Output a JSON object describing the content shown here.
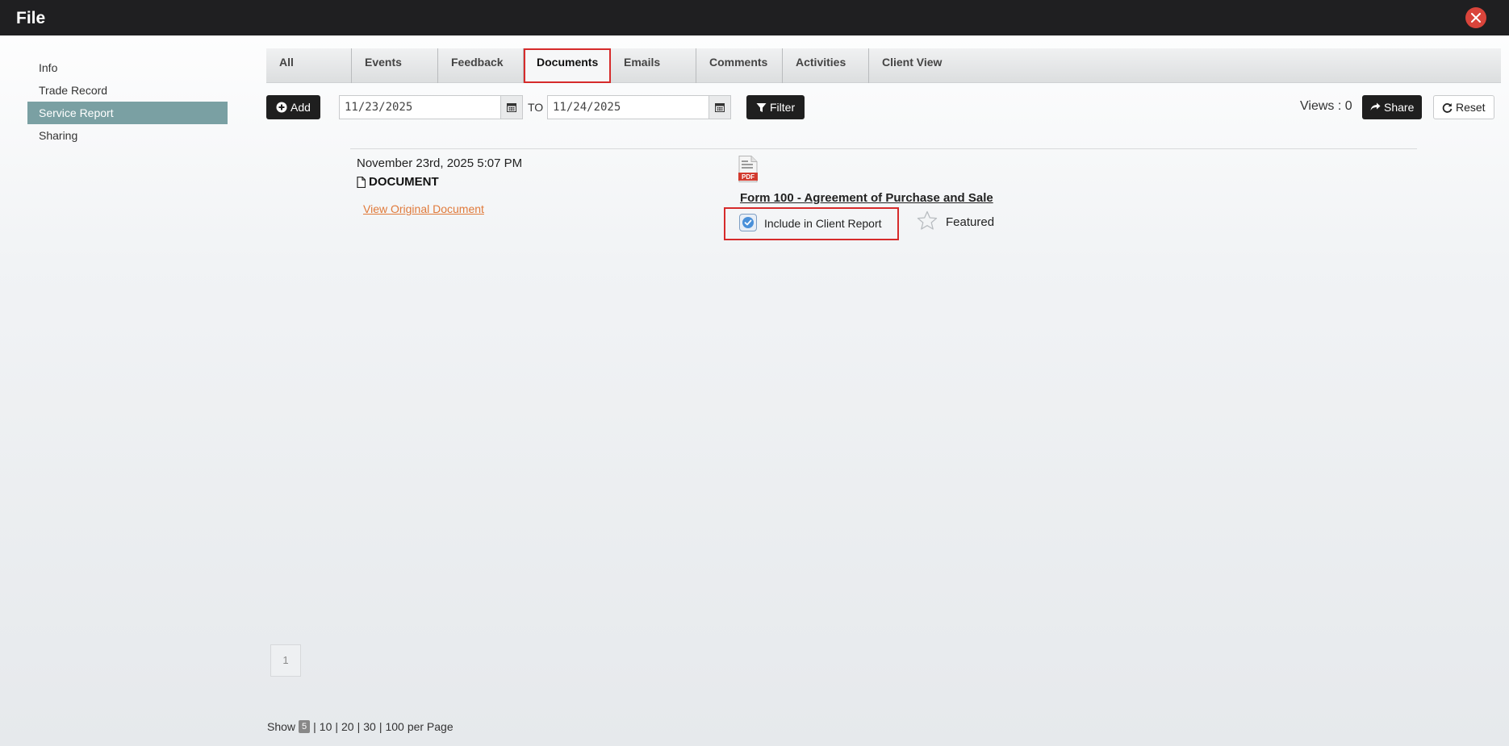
{
  "window": {
    "title": "File"
  },
  "sidebar": {
    "items": [
      {
        "label": "Info"
      },
      {
        "label": "Trade Record"
      },
      {
        "label": "Service Report"
      },
      {
        "label": "Sharing"
      }
    ]
  },
  "tabs": [
    {
      "label": "All"
    },
    {
      "label": "Events"
    },
    {
      "label": "Feedback"
    },
    {
      "label": "Documents"
    },
    {
      "label": "Emails"
    },
    {
      "label": "Comments"
    },
    {
      "label": "Activities"
    },
    {
      "label": "Client View"
    }
  ],
  "toolbar": {
    "add_label": "Add",
    "date_from": "11/23/2025",
    "to_label": "TO",
    "date_to": "11/24/2025",
    "filter_label": "Filter",
    "views_label": "Views : 0",
    "share_label": "Share",
    "reset_label": "Reset"
  },
  "entry": {
    "date": "November 23rd, 2025 5:07 PM",
    "type": "DOCUMENT",
    "view_link": "View Original Document",
    "doc_title": "Form 100 - Agreement of Purchase and Sale",
    "include_label": "Include in Client Report",
    "featured_label": "Featured"
  },
  "pagination": {
    "page": "1",
    "show_label": "Show",
    "selected": "5",
    "options": [
      "10",
      "20",
      "30",
      "100"
    ],
    "suffix": "per Page"
  },
  "colors": {
    "titlebar": "#1f1f21",
    "sidebar_active": "#7aa0a3",
    "highlight": "#d62b2b",
    "link": "#e07a3a",
    "close": "#d9443b"
  }
}
